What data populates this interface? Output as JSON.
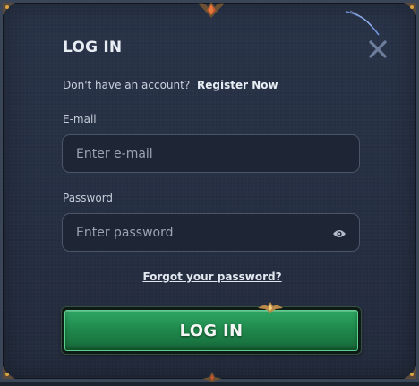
{
  "modal": {
    "title": "LOG IN",
    "close_icon": "close-icon"
  },
  "register": {
    "prompt": "Don't have an account?",
    "link_label": "Register Now"
  },
  "email": {
    "label": "E-mail",
    "placeholder": "Enter e-mail",
    "value": ""
  },
  "password": {
    "label": "Password",
    "placeholder": "Enter password",
    "value": "",
    "toggle_icon": "eye-icon"
  },
  "forgot_label": "Forgot your password?",
  "submit_label": "LOG IN",
  "colors": {
    "background": "#242e41",
    "accent_green": "#1f8a4c",
    "border": "#4a5568",
    "gold": "#d9a441"
  }
}
